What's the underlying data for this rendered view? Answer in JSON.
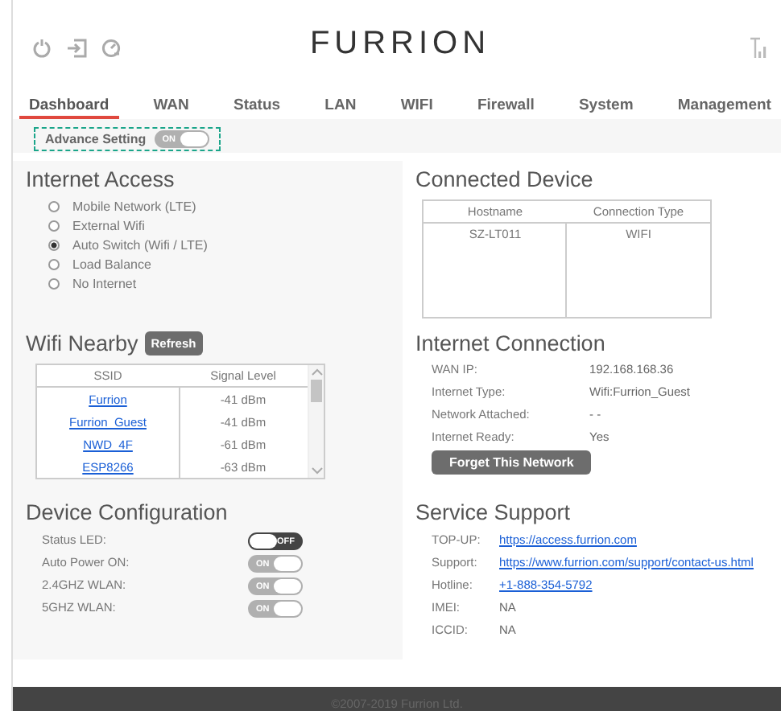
{
  "header": {
    "logo": "FURRION"
  },
  "tabs": [
    {
      "label": "Dashboard",
      "selected": true
    },
    {
      "label": "WAN",
      "selected": false
    },
    {
      "label": "Status",
      "selected": false
    },
    {
      "label": "LAN",
      "selected": false
    },
    {
      "label": "WIFI",
      "selected": false
    },
    {
      "label": "Firewall",
      "selected": false
    },
    {
      "label": "System",
      "selected": false
    },
    {
      "label": "Management",
      "selected": false
    }
  ],
  "advance_setting": {
    "label": "Advance  Setting",
    "toggle": {
      "on": true,
      "text": "ON"
    }
  },
  "internet_access": {
    "title": "Internet Access",
    "options": [
      {
        "label": "Mobile Network (LTE)",
        "selected": false
      },
      {
        "label": "External Wifi",
        "selected": false
      },
      {
        "label": "Auto Switch (Wifi / LTE)",
        "selected": true
      },
      {
        "label": "Load Balance",
        "selected": false
      },
      {
        "label": "No Internet",
        "selected": false
      }
    ]
  },
  "connected_device": {
    "title": "Connected Device",
    "columns": [
      "Hostname",
      "Connection Type"
    ],
    "rows": [
      [
        "SZ-LT011",
        "WIFI"
      ]
    ]
  },
  "wifi_nearby": {
    "title": "Wifi Nearby",
    "refresh_button": "Refresh",
    "columns": [
      "SSID",
      "Signal Level"
    ],
    "rows": [
      {
        "ssid": "Furrion",
        "signal": "-41 dBm"
      },
      {
        "ssid": "Furrion_Guest",
        "signal": "-41 dBm"
      },
      {
        "ssid": "NWD_4F",
        "signal": "-61 dBm"
      },
      {
        "ssid": "ESP8266",
        "signal": "-63 dBm"
      }
    ]
  },
  "internet_connection": {
    "title": "Internet Connection",
    "fields": [
      {
        "label": "WAN IP:",
        "value": "192.168.168.36"
      },
      {
        "label": "Internet Type:",
        "value": "Wifi:Furrion_Guest"
      },
      {
        "label": "Network Attached:",
        "value": "- -"
      },
      {
        "label": "Internet Ready:",
        "value": "Yes"
      }
    ],
    "forget_button": "Forget This Network"
  },
  "device_configuration": {
    "title": "Device Configuration",
    "settings": [
      {
        "label": "Status LED:",
        "toggle": {
          "on": false,
          "text": "OFF"
        }
      },
      {
        "label": "Auto Power ON:",
        "toggle": {
          "on": true,
          "text": "ON"
        }
      },
      {
        "label": "2.4GHZ WLAN:",
        "toggle": {
          "on": true,
          "text": "ON"
        }
      },
      {
        "label": "5GHZ WLAN:",
        "toggle": {
          "on": true,
          "text": "ON"
        }
      }
    ]
  },
  "service_support": {
    "title": "Service Support",
    "fields": [
      {
        "label": "TOP-UP:",
        "value": "https://access.furrion.com",
        "kind": "link"
      },
      {
        "label": "Support:",
        "value": "https://www.furrion.com/support/contact-us.html",
        "kind": "link"
      },
      {
        "label": "Hotline:",
        "value": "+1-888-354-5792",
        "kind": "link"
      },
      {
        "label": "IMEI:",
        "value": "NA",
        "kind": "text"
      },
      {
        "label": "ICCID:",
        "value": "NA",
        "kind": "text"
      }
    ]
  },
  "footer": {
    "copyright": "©2007-2019 Furrion Ltd."
  }
}
